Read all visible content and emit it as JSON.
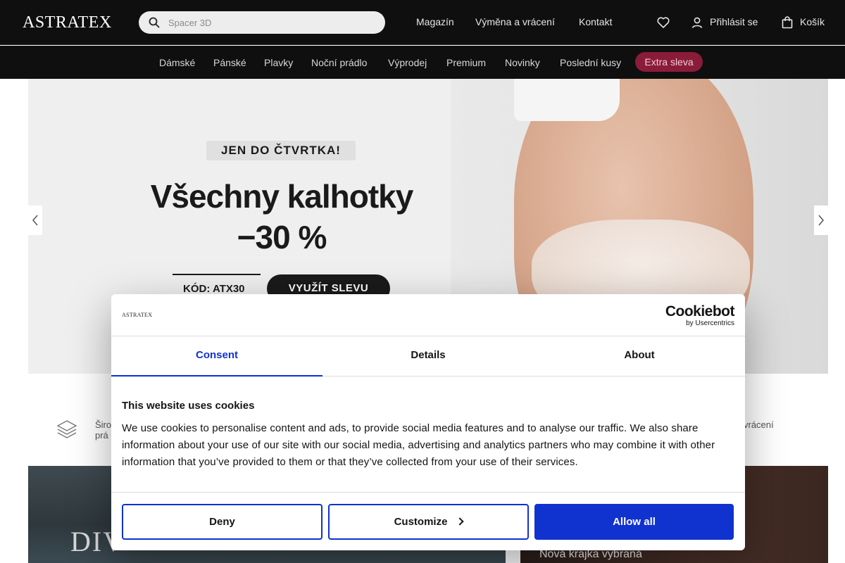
{
  "header": {
    "logo": "ASTRATEX",
    "search": {
      "placeholder": "Spacer 3D"
    },
    "links": [
      "Magazín",
      "Výměna a vrácení",
      "Kontakt"
    ],
    "login_label": "Přihlásit se",
    "cart_label": "Košík"
  },
  "categories": {
    "items": [
      "Dámské",
      "Pánské",
      "Plavky",
      "Noční prádlo",
      "Výprodej",
      "Premium",
      "Novinky",
      "Poslední kusy"
    ],
    "highlight": "Extra sleva"
  },
  "hero": {
    "badge": "JEN DO ČTVRTKA!",
    "title_line1": "Všechny kalhotky",
    "title_line2": "−30 %",
    "code": "KÓD: ATX30",
    "cta": "VYUŽÍT SLEVU"
  },
  "benefits": {
    "left_line1": "Širo",
    "left_line2": "prá",
    "right": "vrácení"
  },
  "banners": {
    "left_text": "DIV",
    "right_text": "Nová krajka vybraná"
  },
  "cookie_dialog": {
    "logo": "ASTRATEX",
    "brand_main": "Cookiebot",
    "brand_sub": "by Usercentrics",
    "tabs": [
      "Consent",
      "Details",
      "About"
    ],
    "active_tab": "Consent",
    "heading": "This website uses cookies",
    "body": "We use cookies to personalise content and ads, to provide social media features and to analyse our traffic. We also share information about your use of our site with our social media, advertising and analytics partners who may combine it with other information that you’ve provided to them or that they’ve collected from your use of their services.",
    "buttons": {
      "deny": "Deny",
      "customize": "Customize",
      "allow": "Allow all"
    }
  },
  "colors": {
    "accent": "#1032cf",
    "header_bg": "#0f0f0f",
    "sale_pill": "#8a1c3a"
  }
}
